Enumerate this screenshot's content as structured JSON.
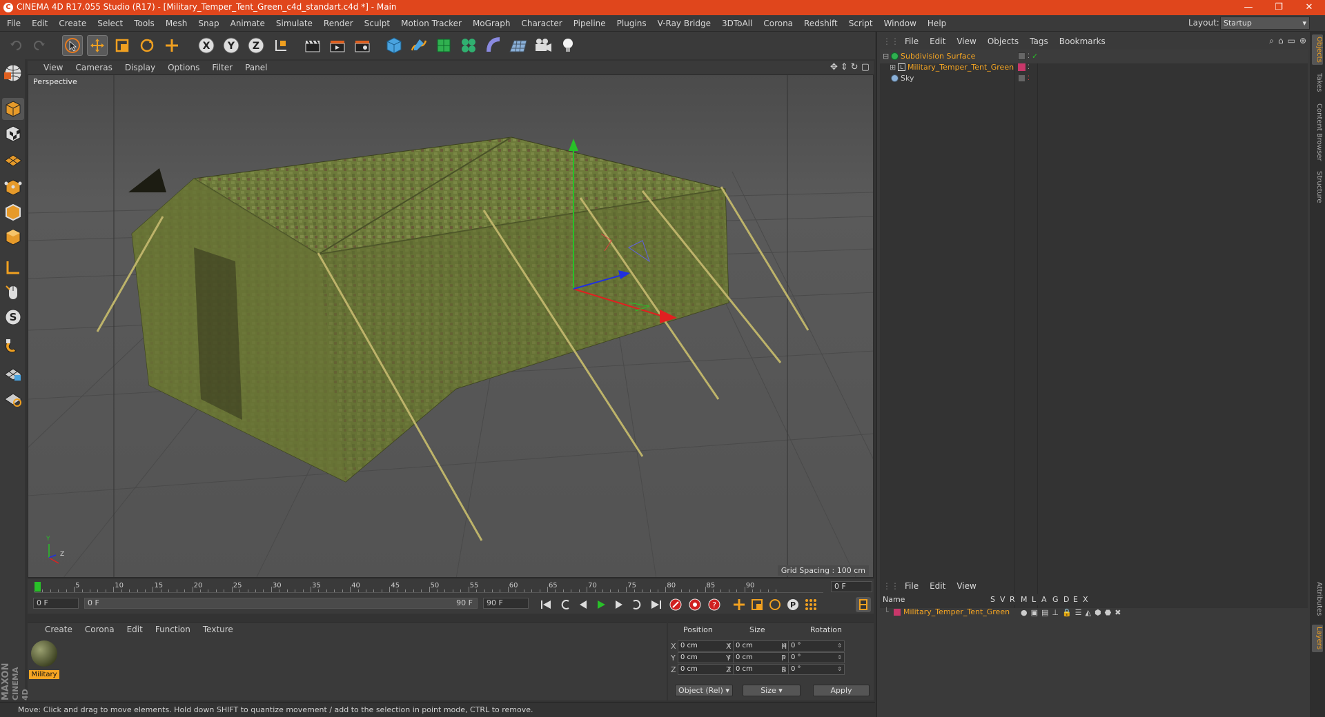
{
  "window": {
    "title": "CINEMA 4D R17.055 Studio (R17) - [Military_Temper_Tent_Green_c4d_standart.c4d *] - Main",
    "controls": [
      "—",
      "❐",
      "✕"
    ]
  },
  "menubar": {
    "items": [
      "File",
      "Edit",
      "Create",
      "Select",
      "Tools",
      "Mesh",
      "Snap",
      "Animate",
      "Simulate",
      "Render",
      "Sculpt",
      "Motion Tracker",
      "MoGraph",
      "Character",
      "Pipeline",
      "Plugins",
      "V-Ray Bridge",
      "3DToAll",
      "Corona",
      "Redshift",
      "Script",
      "Window",
      "Help"
    ],
    "layout_label": "Layout:",
    "layout_value": "Startup"
  },
  "viewport": {
    "menu": [
      "View",
      "Cameras",
      "Display",
      "Options",
      "Filter",
      "Panel"
    ],
    "camera_label": "Perspective",
    "grid_spacing": "Grid Spacing : 100 cm",
    "axis_y": "Y",
    "axis_z": "Z"
  },
  "timeline": {
    "ticks": [
      "0",
      "5",
      "10",
      "15",
      "20",
      "25",
      "30",
      "35",
      "40",
      "45",
      "50",
      "55",
      "60",
      "65",
      "70",
      "75",
      "80",
      "85",
      "90"
    ],
    "current_frame": "0 F",
    "start_field": "0 F",
    "range_start": "0 F",
    "range_end": "90 F",
    "end_field": "90 F"
  },
  "material_panel": {
    "menu": [
      "Create",
      "Corona",
      "Edit",
      "Function",
      "Texture"
    ],
    "material_name": "Military",
    "brand_line1": "MAXON",
    "brand_line2": "CINEMA 4D"
  },
  "coordinates": {
    "headers": [
      "Position",
      "Size",
      "Rotation"
    ],
    "rows": [
      {
        "axis": "X",
        "pos": "0 cm",
        "saxis": "X",
        "size": "0 cm",
        "raxis": "H",
        "rot": "0 °"
      },
      {
        "axis": "Y",
        "pos": "0 cm",
        "saxis": "Y",
        "size": "0 cm",
        "raxis": "P",
        "rot": "0 °"
      },
      {
        "axis": "Z",
        "pos": "0 cm",
        "saxis": "Z",
        "size": "0 cm",
        "raxis": "B",
        "rot": "0 °"
      }
    ],
    "mode_select": "Object (Rel)",
    "size_select": "Size",
    "apply": "Apply"
  },
  "status": {
    "text": "Move: Click and drag to move elements. Hold down SHIFT to quantize movement / add to the selection in point mode, CTRL to remove."
  },
  "object_manager": {
    "menu": [
      "File",
      "Edit",
      "View",
      "Objects",
      "Tags",
      "Bookmarks"
    ],
    "objects": [
      {
        "name": "Subdivision Surface",
        "indent": 0
      },
      {
        "name": "Military_Temper_Tent_Green",
        "indent": 1
      },
      {
        "name": "Sky",
        "indent": 0
      }
    ]
  },
  "layer_manager": {
    "menu": [
      "File",
      "Edit",
      "View"
    ],
    "columns": [
      "Name",
      "S",
      "V",
      "R",
      "M",
      "L",
      "A",
      "G",
      "D",
      "E",
      "X"
    ],
    "layer_name": "Military_Temper_Tent_Green"
  },
  "side_tabs": [
    "Objects",
    "Takes",
    "Content Browser",
    "Structure"
  ],
  "side_tabs_bottom": [
    "Attributes",
    "Layers"
  ],
  "colors": {
    "accent": "#f6a623",
    "title_bar": "#e0461c",
    "layer_color": "#c8376a",
    "tent": "#6d7a3a"
  }
}
